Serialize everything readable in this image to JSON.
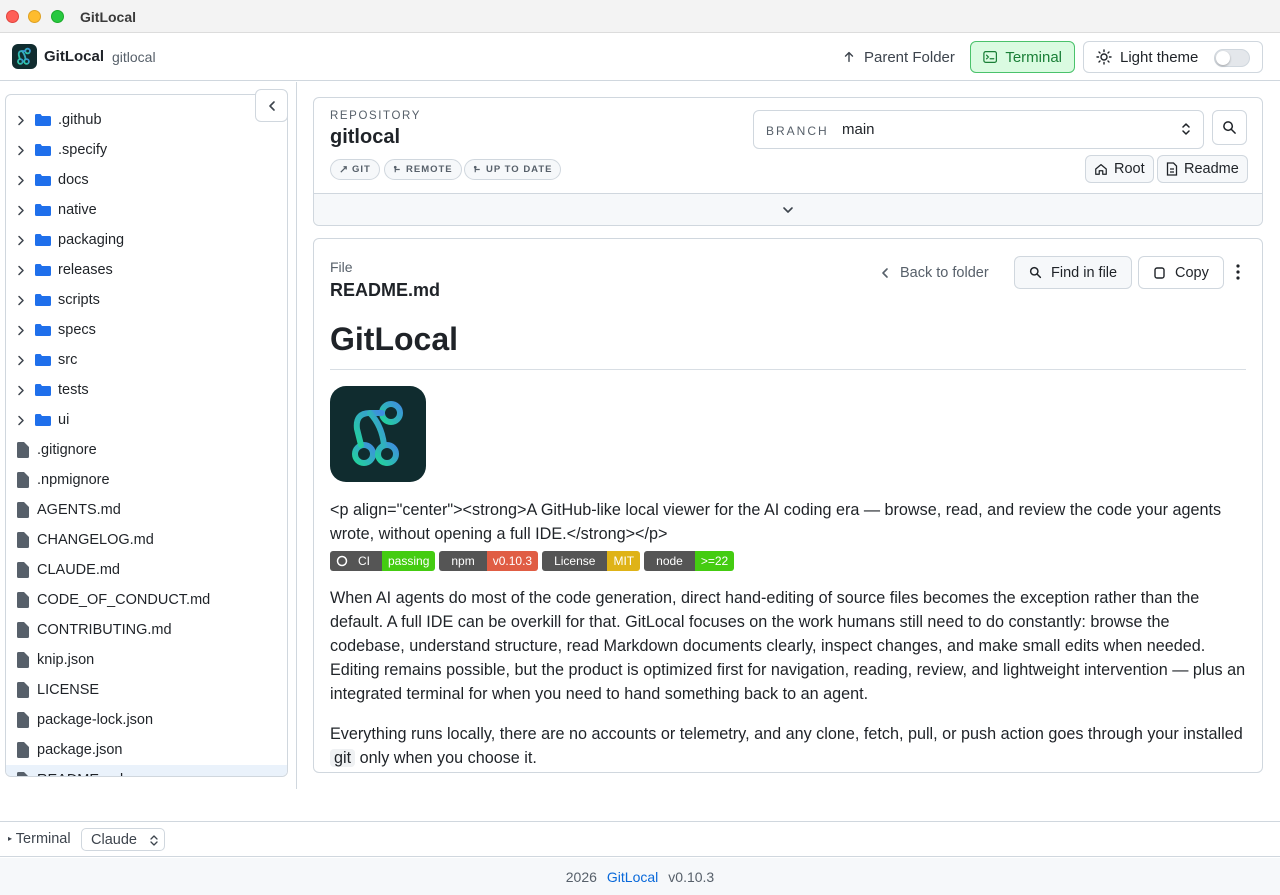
{
  "window": {
    "title": "GitLocal"
  },
  "header": {
    "brand": "GitLocal",
    "repo": "gitlocal",
    "parent_folder": "Parent Folder",
    "terminal": "Terminal",
    "theme": "Light theme",
    "theme_toggle_on": false
  },
  "sidebar": {
    "folders": [
      ".github",
      ".specify",
      "docs",
      "native",
      "packaging",
      "releases",
      "scripts",
      "specs",
      "src",
      "tests",
      "ui"
    ],
    "files": [
      ".gitignore",
      ".npmignore",
      "AGENTS.md",
      "CHANGELOG.md",
      "CLAUDE.md",
      "CODE_OF_CONDUCT.md",
      "CONTRIBUTING.md",
      "knip.json",
      "LICENSE",
      "package-lock.json",
      "package.json",
      "README.md"
    ],
    "selected": "README.md"
  },
  "repository": {
    "label": "REPOSITORY",
    "name": "gitlocal",
    "chips": [
      "GIT",
      "REMOTE",
      "UP TO DATE"
    ],
    "branch_label": "BRANCH",
    "branch": "main",
    "root_btn": "Root",
    "readme_btn": "Readme"
  },
  "file": {
    "label": "File",
    "name": "README.md",
    "back": "Back to folder",
    "find": "Find in file",
    "copy": "Copy"
  },
  "readme": {
    "h1": "GitLocal",
    "tagline": "<p align=\"center\"><strong>A GitHub-like local viewer for the AI coding era — browse, read, and review the code your agents wrote, without opening a full IDE.</strong></p>",
    "badges": [
      {
        "left": "CI",
        "right": "passing",
        "color": "#4c1"
      },
      {
        "left": "npm",
        "right": "v0.10.3",
        "color": "#e05d44"
      },
      {
        "left": "License",
        "right": "MIT",
        "color": "#dfb317"
      },
      {
        "left": "node",
        "right": ">=22",
        "color": "#4c1"
      }
    ],
    "para1": "When AI agents do most of the code generation, direct hand-editing of source files becomes the exception rather than the default. A full IDE can be overkill for that. GitLocal focuses on the work humans still need to do constantly: browse the codebase, understand structure, read Markdown documents clearly, inspect changes, and make small edits when needed. Editing remains possible, but the product is optimized first for navigation, reading, review, and lightweight intervention — plus an integrated terminal for when you need to hand something back to an agent.",
    "para2_start": "Everything runs locally, there are no accounts or telemetry, and any clone, fetch, pull, or push action goes through your installed",
    "para2_code": "git",
    "para2_end": "only when you choose it."
  },
  "terminal_bar": {
    "label": "Terminal",
    "select": "Claude"
  },
  "footer": {
    "year": "2026",
    "brand": "GitLocal",
    "version": "v0.10.3"
  },
  "colors": {
    "accent": "#0969da",
    "folder": "#1f6feb",
    "success": "#1a7f37"
  }
}
